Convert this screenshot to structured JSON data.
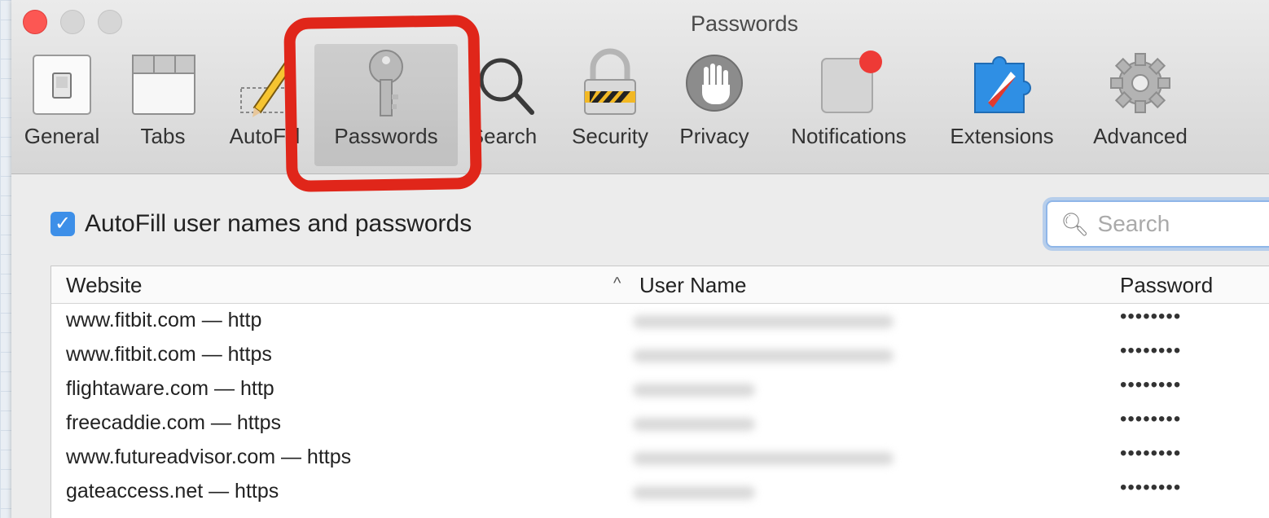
{
  "window": {
    "title": "Passwords"
  },
  "toolbar": {
    "items": [
      {
        "label": "General",
        "icon": "general-switch-icon"
      },
      {
        "label": "Tabs",
        "icon": "tabs-icon"
      },
      {
        "label": "AutoFill",
        "icon": "autofill-pencil-icon"
      },
      {
        "label": "Passwords",
        "icon": "key-icon",
        "selected": true
      },
      {
        "label": "Search",
        "icon": "magnifier-icon"
      },
      {
        "label": "Security",
        "icon": "padlock-icon"
      },
      {
        "label": "Privacy",
        "icon": "hand-stop-icon"
      },
      {
        "label": "Notifications",
        "icon": "notification-badge-icon"
      },
      {
        "label": "Extensions",
        "icon": "puzzle-compass-icon"
      },
      {
        "label": "Advanced",
        "icon": "gear-icon"
      }
    ]
  },
  "autofill": {
    "checked": true,
    "label": "AutoFill user names and passwords"
  },
  "search": {
    "placeholder": "Search"
  },
  "table": {
    "columns": {
      "website": "Website",
      "username": "User Name",
      "password": "Password"
    },
    "sort_indicator": "^",
    "rows": [
      {
        "website": "www.fitbit.com — http",
        "password": "••••••••"
      },
      {
        "website": "www.fitbit.com — https",
        "password": "••••••••"
      },
      {
        "website": "flightaware.com — http",
        "password": "••••••••"
      },
      {
        "website": "freecaddie.com — https",
        "password": "••••••••"
      },
      {
        "website": "www.futureadvisor.com — https",
        "password": "••••••••"
      },
      {
        "website": "gateaccess.net — https",
        "password": "••••••••"
      }
    ]
  },
  "colors": {
    "highlight": "#e0261a",
    "checkbox": "#3d8fe8",
    "close_button": "#fc5753"
  }
}
